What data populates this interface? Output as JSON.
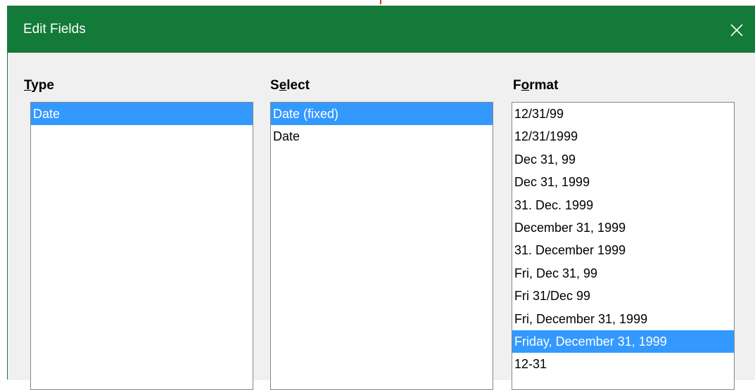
{
  "window": {
    "title": "Edit Fields",
    "close_glyph": "×",
    "titlebar_color": "#137a3a",
    "selection_color": "#3399ff"
  },
  "type_column": {
    "label_accel": "T",
    "label_rest": "ype",
    "items": [
      "Date"
    ],
    "selected_index": 0
  },
  "select_column": {
    "label_pre": "S",
    "label_accel": "e",
    "label_rest": "lect",
    "items": [
      "Date (fixed)",
      "Date"
    ],
    "selected_index": 0
  },
  "format_column": {
    "label_pre": "F",
    "label_accel": "o",
    "label_rest": "rmat",
    "items": [
      "12/31/99",
      "12/31/1999",
      "Dec 31, 99",
      "Dec 31, 1999",
      "31. Dec. 1999",
      "December 31, 1999",
      "31. December 1999",
      "Fri, Dec 31, 99",
      "Fri 31/Dec 99",
      "Fri, December 31, 1999",
      "Friday, December 31, 1999",
      "12-31"
    ],
    "selected_index": 10
  }
}
